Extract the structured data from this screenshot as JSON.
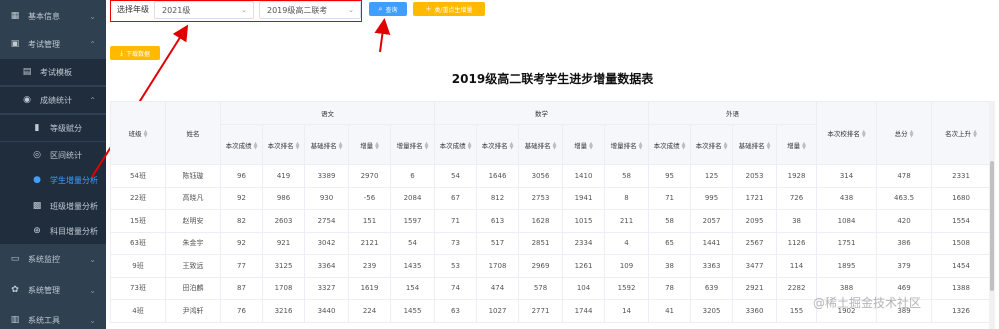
{
  "sidebar": {
    "items": [
      {
        "label": "基本信息",
        "icon": "grid-icon",
        "glyph": "▦",
        "arrow": "⌄"
      },
      {
        "label": "考试管理",
        "icon": "folder-icon",
        "glyph": "▣",
        "arrow": "⌃"
      },
      {
        "label": "考试模板",
        "icon": "document-icon",
        "glyph": "▤"
      },
      {
        "label": "成绩统计",
        "icon": "eye-icon",
        "glyph": "◉",
        "arrow": "⌃"
      },
      {
        "label": "等级赋分",
        "icon": "bar-chart-icon",
        "glyph": "▮"
      },
      {
        "label": "区间统计",
        "icon": "target-icon",
        "glyph": "◎"
      },
      {
        "label": "学生增量分析",
        "icon": "cursor-icon",
        "glyph": "●"
      },
      {
        "label": "班级增量分析",
        "icon": "table-icon",
        "glyph": "▩"
      },
      {
        "label": "科目增量分析",
        "icon": "plus-circle-icon",
        "glyph": "⊕"
      },
      {
        "label": "系统监控",
        "icon": "monitor-icon",
        "glyph": "▭",
        "arrow": "⌄"
      },
      {
        "label": "系统管理",
        "icon": "gear-icon",
        "glyph": "✿",
        "arrow": "⌄"
      },
      {
        "label": "系统工具",
        "icon": "tool-icon",
        "glyph": "▥",
        "arrow": "⌄"
      }
    ]
  },
  "toolbar": {
    "grade_label": "选择年级",
    "grade_value": "2021级",
    "exam_value": "2019级高二联考",
    "search_label": "查询",
    "stats_label": "类/重点生增量",
    "download_label": "下载数据"
  },
  "report": {
    "title": "2019级高二联考学生进步增量数据表"
  },
  "table": {
    "col_class": "班级",
    "col_name": "姓名",
    "groups": [
      "语文",
      "数学",
      "外语"
    ],
    "sub_headers": [
      "本次成绩",
      "本次排名",
      "基础排名",
      "增量",
      "增量排名"
    ],
    "col_school_rank": "本次校排名",
    "col_total": "总分",
    "col_rank_up": "名次上升",
    "rows": [
      [
        "54班",
        "陈钰璇",
        "96",
        "419",
        "3389",
        "2970",
        "6",
        "54",
        "1646",
        "3056",
        "1410",
        "58",
        "95",
        "125",
        "2053",
        "1928",
        "314",
        "478",
        "2331"
      ],
      [
        "22班",
        "高晓凡",
        "92",
        "986",
        "930",
        "-56",
        "2084",
        "67",
        "812",
        "2753",
        "1941",
        "8",
        "71",
        "995",
        "1721",
        "726",
        "438",
        "463.5",
        "1680"
      ],
      [
        "15班",
        "赵明安",
        "82",
        "2603",
        "2754",
        "151",
        "1597",
        "71",
        "613",
        "1628",
        "1015",
        "211",
        "58",
        "2057",
        "2095",
        "38",
        "1084",
        "420",
        "1554"
      ],
      [
        "63班",
        "朱金宇",
        "92",
        "921",
        "3042",
        "2121",
        "54",
        "73",
        "517",
        "2851",
        "2334",
        "4",
        "65",
        "1441",
        "2567",
        "1126",
        "1751",
        "386",
        "1508"
      ],
      [
        "9班",
        "王致远",
        "77",
        "3125",
        "3364",
        "239",
        "1435",
        "53",
        "1708",
        "2969",
        "1261",
        "109",
        "38",
        "3363",
        "3477",
        "114",
        "1895",
        "379",
        "1454"
      ],
      [
        "73班",
        "田泊麟",
        "87",
        "1708",
        "3327",
        "1619",
        "154",
        "74",
        "474",
        "578",
        "104",
        "1592",
        "78",
        "639",
        "2921",
        "2282",
        "388",
        "469",
        "1388"
      ],
      [
        "4班",
        "尹鸿轩",
        "76",
        "3216",
        "3440",
        "224",
        "1455",
        "63",
        "1027",
        "2771",
        "1744",
        "14",
        "41",
        "3205",
        "3360",
        "155",
        "1902",
        "389",
        "1326"
      ]
    ]
  },
  "watermark": "@稀土掘金技术社区",
  "colors": {
    "sidebar_bg": "#2f4050",
    "accent_blue": "#409eff",
    "accent_orange": "#ffba00",
    "annotation_red": "#e00000"
  }
}
